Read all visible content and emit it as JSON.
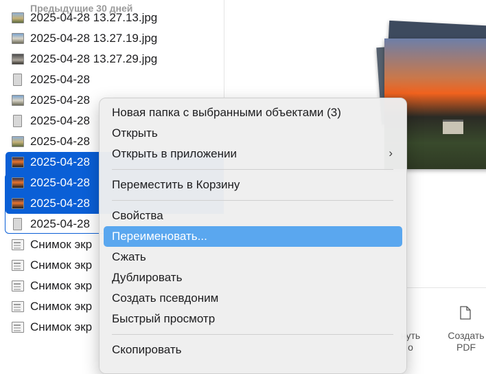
{
  "file_list": {
    "section_header": "Предыдущие 30 дней",
    "rows": [
      {
        "name": "2025-04-28 13.27.13.jpg",
        "thumb": "photo-a",
        "selected": false
      },
      {
        "name": "2025-04-28 13.27.19.jpg",
        "thumb": "photo-b",
        "selected": false
      },
      {
        "name": "2025-04-28 13.27.29.jpg",
        "thumb": "photo-c",
        "selected": false
      },
      {
        "name": "2025-04-28",
        "thumb": "portrait",
        "selected": false
      },
      {
        "name": "2025-04-28",
        "thumb": "photo-b",
        "selected": false
      },
      {
        "name": "2025-04-28",
        "thumb": "portrait",
        "selected": false
      },
      {
        "name": "2025-04-28",
        "thumb": "photo-a",
        "selected": false
      },
      {
        "name": "2025-04-28",
        "thumb": "sunset",
        "selected": true
      },
      {
        "name": "2025-04-28",
        "thumb": "sunset",
        "selected": true
      },
      {
        "name": "2025-04-28",
        "thumb": "sunset",
        "selected": true
      },
      {
        "name": "2025-04-28",
        "thumb": "portrait",
        "selected": false
      },
      {
        "name": "Снимок экр",
        "thumb": "shot",
        "selected": false
      },
      {
        "name": "Снимок экр",
        "thumb": "shot",
        "selected": false
      },
      {
        "name": "Снимок экр",
        "thumb": "shot",
        "selected": false
      },
      {
        "name": "Снимок экр",
        "thumb": "shot",
        "selected": false
      },
      {
        "name": "Снимок экр",
        "thumb": "shot",
        "selected": false
      }
    ]
  },
  "preview": {
    "toolbar": {
      "rotate_label": "нуть\nо",
      "pdf_label": "Создать\nPDF"
    }
  },
  "context_menu": {
    "items": [
      {
        "label": "Новая папка с выбранными объектами (3)",
        "submenu": false,
        "highlighted": false
      },
      {
        "label": "Открыть",
        "submenu": false,
        "highlighted": false
      },
      {
        "label": "Открыть в приложении",
        "submenu": true,
        "highlighted": false
      },
      {
        "separator": true
      },
      {
        "label": "Переместить в Корзину",
        "submenu": false,
        "highlighted": false
      },
      {
        "separator": true
      },
      {
        "label": "Свойства",
        "submenu": false,
        "highlighted": false
      },
      {
        "label": "Переименовать...",
        "submenu": false,
        "highlighted": true
      },
      {
        "label": "Сжать",
        "submenu": false,
        "highlighted": false
      },
      {
        "label": "Дублировать",
        "submenu": false,
        "highlighted": false
      },
      {
        "label": "Создать псевдоним",
        "submenu": false,
        "highlighted": false
      },
      {
        "label": "Быстрый просмотр",
        "submenu": false,
        "highlighted": false
      },
      {
        "separator": true
      },
      {
        "label": "Скопировать",
        "submenu": false,
        "highlighted": false
      }
    ],
    "chevron_glyph": "›"
  },
  "colors": {
    "selection": "#0a5fd6",
    "menu_highlight": "#5aa7ef"
  }
}
